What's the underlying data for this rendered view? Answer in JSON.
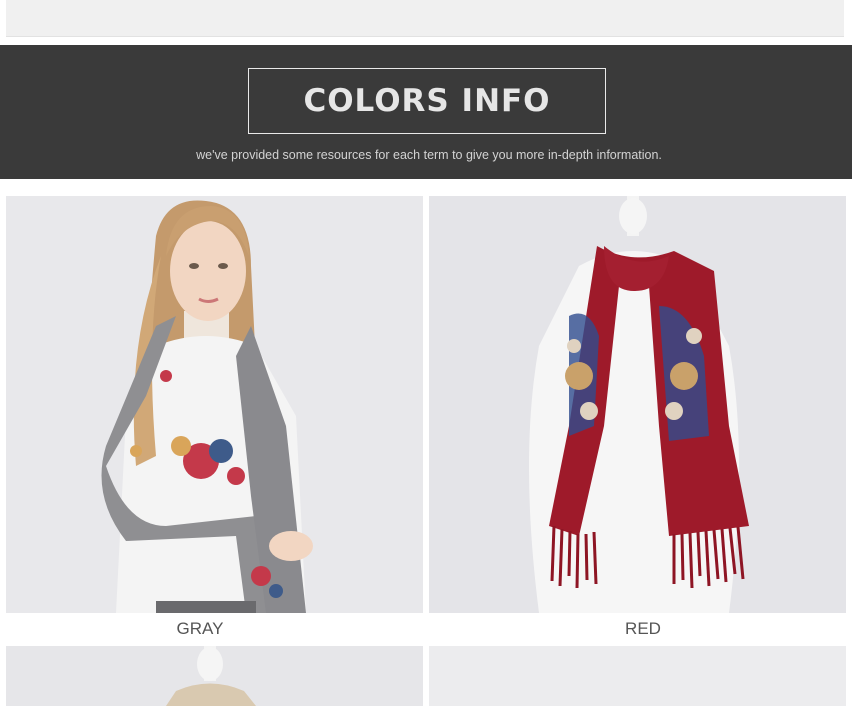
{
  "banner": {
    "title": "COLORS INFO",
    "subtitle": "we've provided some resources for each term to give you more in-depth information."
  },
  "products": [
    {
      "label": "GRAY",
      "scarf_color": "#8f8f92",
      "background": "#e8e8ea"
    },
    {
      "label": "RED",
      "scarf_color": "#9e1a2a",
      "background": "#e5e5e9"
    }
  ],
  "colors": {
    "banner_bg": "#3a3a3a",
    "gray_scarf": "#8f8f92",
    "red_scarf": "#9e1a2a",
    "beige_scarf": "#d9c9b0"
  }
}
